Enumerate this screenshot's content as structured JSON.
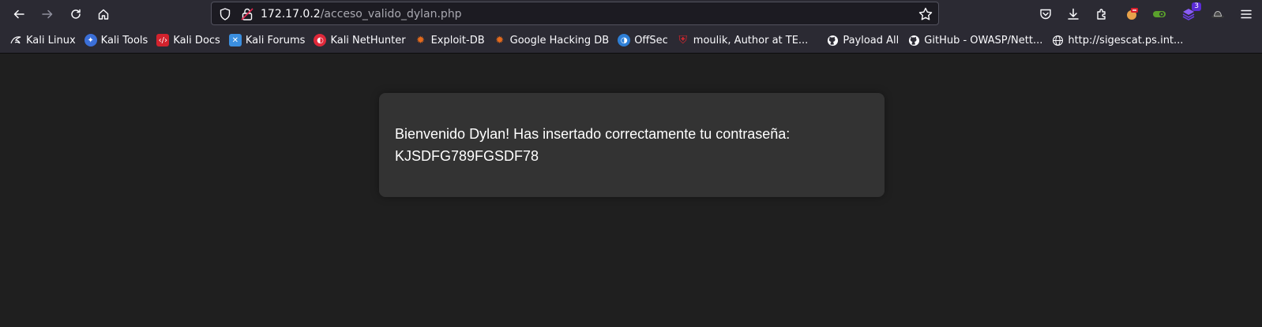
{
  "browser": {
    "url_host": "172.17.0.2",
    "url_path": "/acceso_valido_dylan.php",
    "extensions_badge": "3",
    "nav_icons": [
      "back-arrow-icon",
      "forward-arrow-icon",
      "reload-icon",
      "home-icon"
    ],
    "toolbar_icons": [
      "pocket-icon",
      "download-icon",
      "extensions-puzzle-icon",
      "foxyproxy-icon",
      "cookie-editor-icon",
      "wappalyzer-icon",
      "hat-icon",
      "hamburger-menu-icon"
    ]
  },
  "bookmarks": [
    {
      "label": "Kali Linux",
      "icon": "kali-dragon-icon",
      "color": "#2b2a33"
    },
    {
      "label": "Kali Tools",
      "icon": "kali-tools-icon",
      "color": "#3b6fd8"
    },
    {
      "label": "Kali Docs",
      "icon": "kali-docs-icon",
      "color": "#d2222d"
    },
    {
      "label": "Kali Forums",
      "icon": "kali-forums-icon",
      "color": "#3b8fe0"
    },
    {
      "label": "Kali NetHunter",
      "icon": "nethunter-icon",
      "color": "#e0283a"
    },
    {
      "label": "Exploit-DB",
      "icon": "exploit-db-icon",
      "color": "#e46a1c"
    },
    {
      "label": "Google Hacking DB",
      "icon": "ghdb-icon",
      "color": "#e46a1c"
    },
    {
      "label": "OffSec",
      "icon": "offsec-icon",
      "color": "#2e7fd6"
    },
    {
      "label": "moulik, Author at TE...",
      "icon": "shield-red-icon",
      "color": "#d9262e"
    },
    {
      "label": "Payload All",
      "icon": "github-icon",
      "color": "#2b2a33"
    },
    {
      "label": "GitHub - OWASP/Nett...",
      "icon": "github-icon",
      "color": "#2b2a33"
    },
    {
      "label": "http://sigescat.ps.int...",
      "icon": "globe-icon",
      "color": "#2b2a33"
    }
  ],
  "page": {
    "message_line1": "Bienvenido Dylan! Has insertado correctamente tu contraseña:",
    "password": "KJSDFG789FGSDF78"
  }
}
